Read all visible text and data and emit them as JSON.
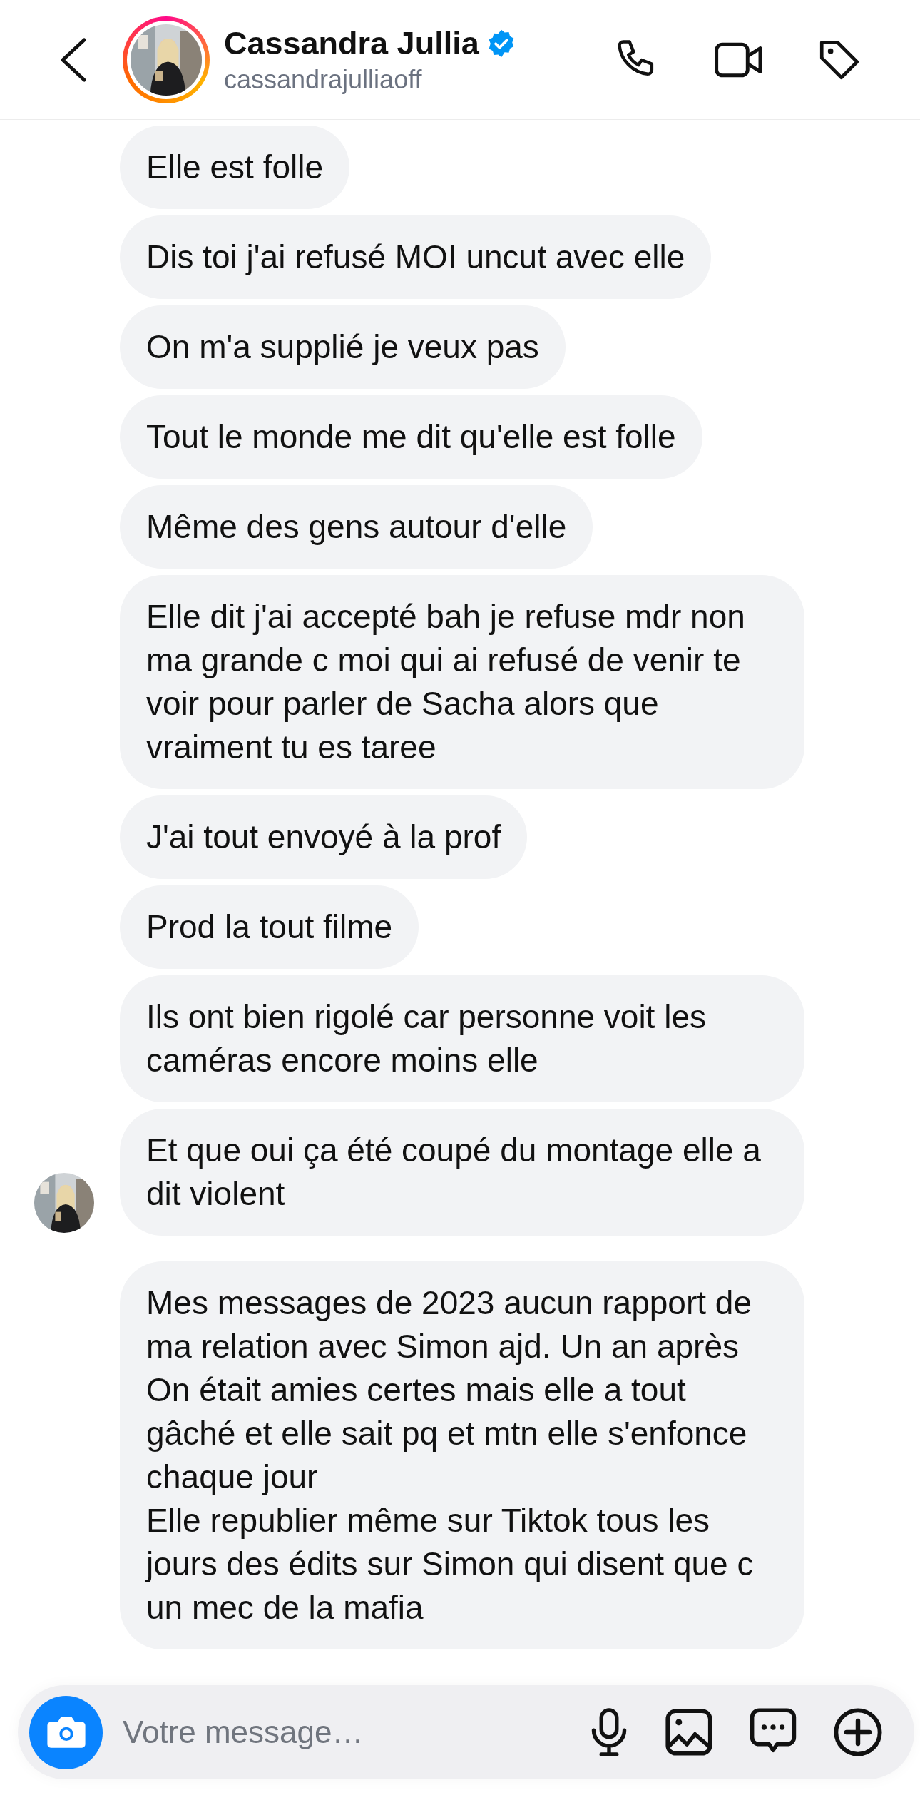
{
  "header": {
    "name": "Cassandra Jullia",
    "verified": true,
    "username": "cassandrajulliaoff"
  },
  "groups": [
    {
      "avatar": true,
      "messages": [
        "Elle est folle",
        "Dis toi j'ai refusé MOI uncut avec elle",
        "On m'a supplié je veux pas",
        "Tout le monde me dit qu'elle est folle",
        "Même des gens autour d'elle",
        "Elle dit j'ai accepté bah je refuse mdr non ma grande c moi qui ai refusé de venir te voir pour parler de Sacha alors que vraiment tu es taree",
        "J'ai tout envoyé à la prof",
        "Prod la tout filme",
        "Ils ont bien rigolé car personne voit les caméras encore moins elle",
        "Et que oui ça été coupé du montage elle a dit violent"
      ]
    },
    {
      "avatar": false,
      "messages": [
        "Mes messages de 2023 aucun rapport de ma relation avec Simon ajd. Un an après\nOn était amies certes mais elle a tout gâché et elle sait pq et mtn elle s'enfonce chaque jour\nElle republier même sur Tiktok tous les jours des édits sur Simon qui disent que c un mec de la mafia"
      ]
    }
  ],
  "composer": {
    "placeholder": "Votre message…"
  }
}
